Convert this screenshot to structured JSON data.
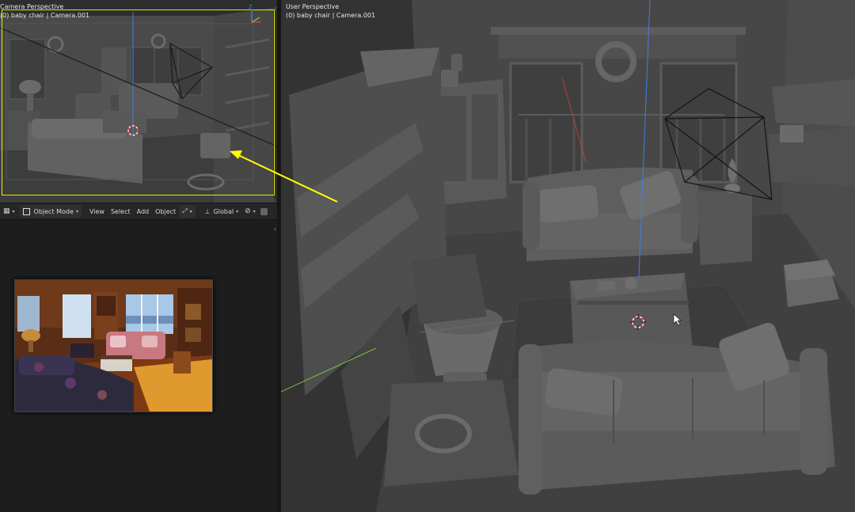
{
  "camera_viewport": {
    "title": "Camera Perspective",
    "subtitle": "(0) baby chair | Camera.001"
  },
  "header": {
    "mode": "Object Mode",
    "menu": [
      "View",
      "Select",
      "Add",
      "Object"
    ],
    "transform_orientation": "Global"
  },
  "user_viewport": {
    "title": "User Perspective",
    "subtitle": "(0) baby chair | Camera.001"
  },
  "colors": {
    "annotation_arrow": "#ffff00",
    "camera_frame": "#e8e800",
    "viewport_bg": "#3a3a3a",
    "axis_z": "#3f7fe0",
    "axis_x": "#d04040",
    "axis_y": "#7cc040"
  },
  "icons": [
    "viewport-editor-icon",
    "mode-icon",
    "orientation-icon",
    "pivot-icon",
    "snap-icon",
    "axis-gizmo-icon",
    "3d-cursor-icon",
    "camera-object-icon",
    "mouse-pointer-icon"
  ]
}
